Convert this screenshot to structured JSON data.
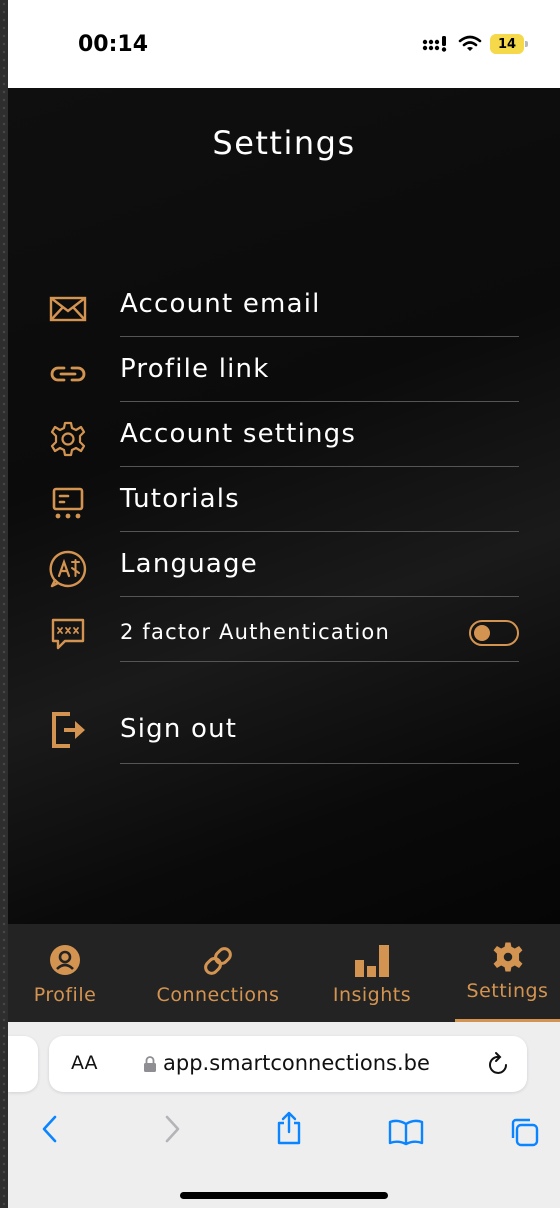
{
  "status_bar": {
    "time": "00:14",
    "battery": "14"
  },
  "page": {
    "title": "Settings"
  },
  "settings_items": [
    {
      "label": "Account email",
      "icon": "envelope-icon"
    },
    {
      "label": "Profile link",
      "icon": "link-icon"
    },
    {
      "label": "Account settings",
      "icon": "gear-icon"
    },
    {
      "label": "Tutorials",
      "icon": "tutorial-board-icon"
    },
    {
      "label": "Language",
      "icon": "translate-icon"
    },
    {
      "label": "2 factor Authentication",
      "icon": "password-chat-icon",
      "toggle_on": false
    },
    {
      "label": "Sign out",
      "icon": "sign-out-icon"
    }
  ],
  "bottom_nav": [
    {
      "label": "Profile",
      "icon": "user-icon"
    },
    {
      "label": "Connections",
      "icon": "link-icon"
    },
    {
      "label": "Insights",
      "icon": "bar-chart-icon"
    },
    {
      "label": "Settings",
      "icon": "gear-icon",
      "active": true
    }
  ],
  "browser": {
    "aa_label": "AA",
    "url": "app.smartconnections.be"
  },
  "colors": {
    "accent": "#d49451",
    "background": "#0b0b0b",
    "nav_background": "#232323",
    "divider": "#555555"
  }
}
